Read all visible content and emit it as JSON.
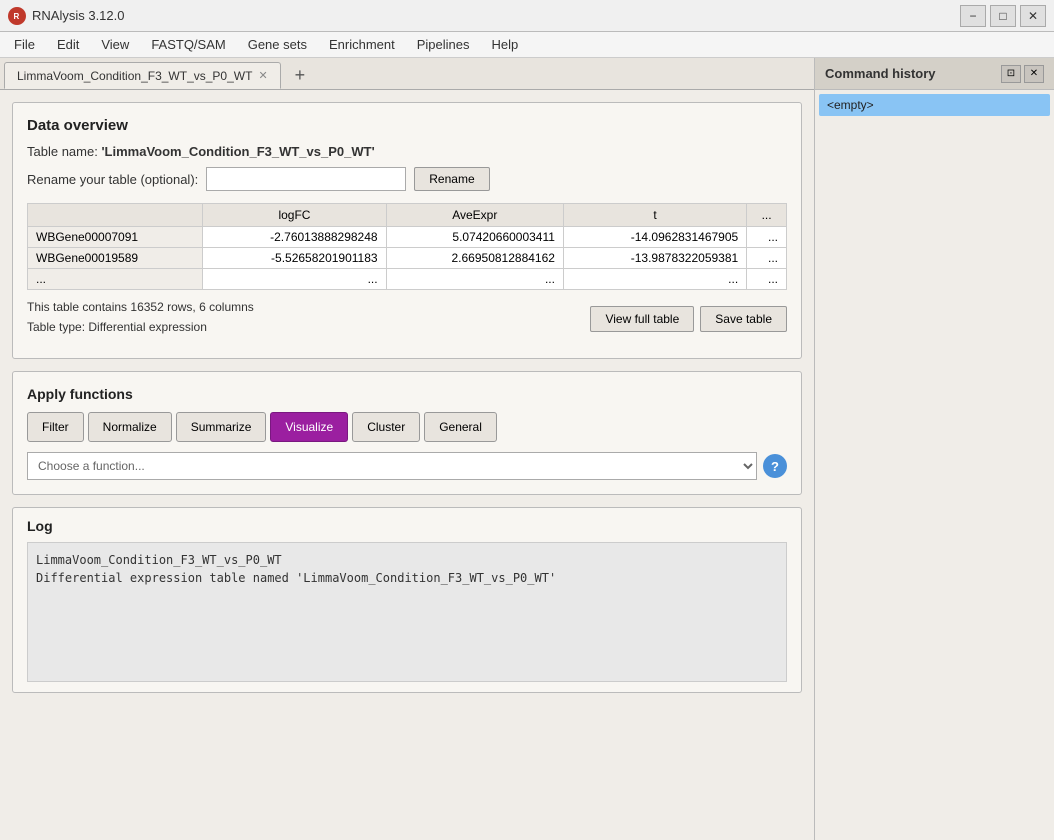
{
  "titlebar": {
    "app_name": "RNAlysis 3.12.0",
    "app_icon": "R",
    "tab_label": "LimmaVoom_Condition_F3_WT_vs_P0_WT",
    "minimize": "−",
    "maximize": "□",
    "close": "✕"
  },
  "menu": {
    "items": [
      "File",
      "Edit",
      "View",
      "FASTQ/SAM",
      "Gene sets",
      "Enrichment",
      "Pipelines",
      "Help"
    ]
  },
  "data_overview": {
    "section_title": "Data overview",
    "table_name_label": "Table name:",
    "table_name_value": "'LimmaVoom_Condition_F3_WT_vs_P0_WT'",
    "rename_label": "Rename your table (optional):",
    "rename_placeholder": "",
    "rename_btn": "Rename",
    "table": {
      "headers": [
        "",
        "logFC",
        "AveExpr",
        "t",
        "..."
      ],
      "rows": [
        [
          "WBGene00007091",
          "-2.76013888298248",
          "5.07420660003411",
          "-14.0962831467905",
          "..."
        ],
        [
          "WBGene00019589",
          "-5.52658201901183",
          "2.66950812884162",
          "-13.9878322059381",
          "..."
        ],
        [
          "...",
          "...",
          "...",
          "...",
          "..."
        ]
      ]
    },
    "table_info": "This table contains 16352 rows, 6 columns",
    "table_type": "Table type: Differential expression",
    "view_full_table_btn": "View full table",
    "save_table_btn": "Save table"
  },
  "apply_functions": {
    "section_title": "Apply functions",
    "tabs": [
      {
        "label": "Filter",
        "active": false
      },
      {
        "label": "Normalize",
        "active": false
      },
      {
        "label": "Summarize",
        "active": false
      },
      {
        "label": "Visualize",
        "active": true
      },
      {
        "label": "Cluster",
        "active": false
      },
      {
        "label": "General",
        "active": false
      }
    ],
    "function_placeholder": "Choose a function...",
    "help_btn": "?"
  },
  "log": {
    "title": "Log",
    "line1": "LimmaVoom_Condition_F3_WT_vs_P0_WT",
    "line2": "Differential expression table named 'LimmaVoom_Condition_F3_WT_vs_P0_WT'"
  },
  "command_history": {
    "title": "Command history",
    "empty_label": "<empty>",
    "restore_btn": "⊡",
    "close_btn": "✕"
  }
}
